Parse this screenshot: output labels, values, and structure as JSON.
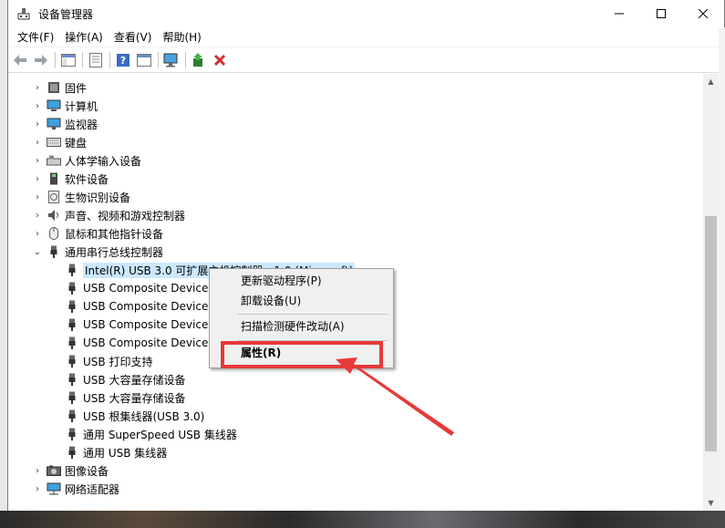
{
  "window": {
    "title": "设备管理器"
  },
  "menubar": {
    "items": [
      "文件(F)",
      "操作(A)",
      "查看(V)",
      "帮助(H)"
    ]
  },
  "tree": {
    "items": [
      {
        "label": "固件",
        "icon": "firmware-icon",
        "expanded": false,
        "level": 0
      },
      {
        "label": "计算机",
        "icon": "computer-icon",
        "expanded": false,
        "level": 0
      },
      {
        "label": "监视器",
        "icon": "monitor-icon",
        "expanded": false,
        "level": 0
      },
      {
        "label": "键盘",
        "icon": "keyboard-icon",
        "expanded": false,
        "level": 0
      },
      {
        "label": "人体学输入设备",
        "icon": "hid-icon",
        "expanded": false,
        "level": 0
      },
      {
        "label": "软件设备",
        "icon": "software-device-icon",
        "expanded": false,
        "level": 0
      },
      {
        "label": "生物识别设备",
        "icon": "biometric-icon",
        "expanded": false,
        "level": 0
      },
      {
        "label": "声音、视频和游戏控制器",
        "icon": "audio-icon",
        "expanded": false,
        "level": 0
      },
      {
        "label": "鼠标和其他指针设备",
        "icon": "mouse-icon",
        "expanded": false,
        "level": 0
      },
      {
        "label": "通用串行总线控制器",
        "icon": "usb-icon",
        "expanded": true,
        "level": 0
      },
      {
        "label": "Intel(R) USB 3.0 可扩展主机控制器 - 1.0 (Microsoft)",
        "icon": "usb-icon",
        "level": 1,
        "selected": true
      },
      {
        "label": "USB Composite Device",
        "icon": "usb-icon",
        "level": 1
      },
      {
        "label": "USB Composite Device",
        "icon": "usb-icon",
        "level": 1
      },
      {
        "label": "USB Composite Device",
        "icon": "usb-icon",
        "level": 1
      },
      {
        "label": "USB Composite Device",
        "icon": "usb-icon",
        "level": 1
      },
      {
        "label": "USB 打印支持",
        "icon": "usb-icon",
        "level": 1
      },
      {
        "label": "USB 大容量存储设备",
        "icon": "usb-icon",
        "level": 1
      },
      {
        "label": "USB 大容量存储设备",
        "icon": "usb-icon",
        "level": 1
      },
      {
        "label": "USB 根集线器(USB 3.0)",
        "icon": "usb-icon",
        "level": 1
      },
      {
        "label": "通用 SuperSpeed USB 集线器",
        "icon": "usb-icon",
        "level": 1
      },
      {
        "label": "通用 USB 集线器",
        "icon": "usb-icon",
        "level": 1
      },
      {
        "label": "图像设备",
        "icon": "camera-icon",
        "expanded": false,
        "level": 0
      },
      {
        "label": "网络适配器",
        "icon": "network-icon",
        "expanded": false,
        "level": 0
      }
    ]
  },
  "context_menu": {
    "items": [
      {
        "label": "更新驱动程序(P)"
      },
      {
        "label": "卸载设备(U)"
      },
      {
        "label": "扫描检测硬件改动(A)"
      },
      {
        "label": "属性(R)",
        "bold": true
      }
    ]
  },
  "colors": {
    "highlight": "#e63a3a",
    "selection": "#cce8ff"
  }
}
